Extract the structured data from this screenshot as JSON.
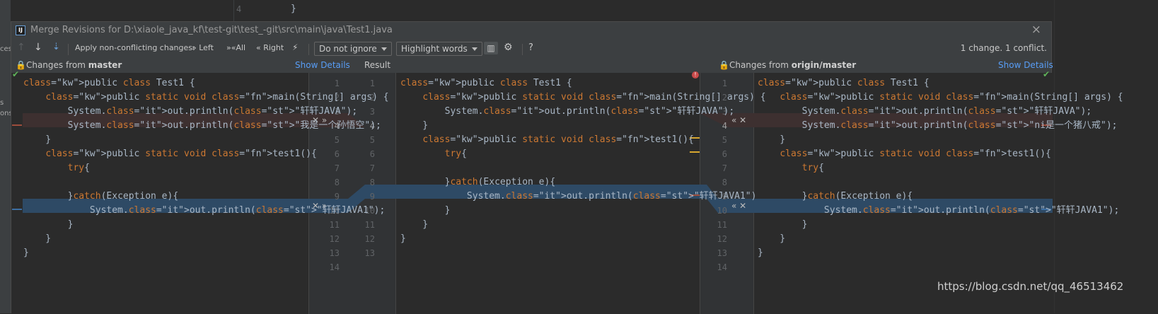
{
  "background": {
    "editor_line_number": "4",
    "editor_line_text": "}",
    "left_strip_fragments": [
      "s",
      "ces",
      "s",
      "ons"
    ]
  },
  "dialog": {
    "title": "Merge Revisions for D:\\xiaole_java_kf\\test-git\\test_-git\\src\\main\\java\\Test1.java",
    "logo_text": "IJ",
    "close_icon": "×"
  },
  "toolbar": {
    "up_arrow": "↑",
    "down_arrow": "↓",
    "apply_label": "Apply non-conflicting changes:",
    "left_label": "Left",
    "all_label": "All",
    "right_label": "Right",
    "ignore_option": "Do not ignore",
    "highlight_option": "Highlight words",
    "help_label": "?",
    "status": "1 change. 1 conflict."
  },
  "headers": {
    "left_prefix": "Changes from ",
    "left_branch": "master",
    "show_details": "Show Details",
    "result": "Result",
    "right_prefix": "Changes from ",
    "right_branch": "origin/master"
  },
  "gutter_numbers": [
    "1",
    "2",
    "3",
    "4",
    "5",
    "6",
    "7",
    "8",
    "9",
    "10",
    "11",
    "12",
    "13",
    "14"
  ],
  "result_numbers": [
    "1",
    "2",
    "3",
    "4",
    "5",
    "6",
    "7",
    "8",
    "9",
    "10",
    "11",
    "12",
    "13"
  ],
  "left_code": [
    "public class Test1 {",
    "    public static void main(String[] args) {",
    "        System.out.println(\"轩轩JAVA\");",
    "        System.out.println(\"我是一个孙悟空\");",
    "    }",
    "    public static void test1(){",
    "        try{",
    "",
    "        }catch(Exception e){",
    "            System.out.println(\"轩轩JAVA1\");",
    "        }",
    "    }",
    "}"
  ],
  "center_code": [
    "public class Test1 {",
    "    public static void main(String[] args) {",
    "        System.out.println(\"轩轩JAVA\");",
    "    }",
    "    public static void test1(){",
    "        try{",
    "",
    "        }catch(Exception e){",
    "            System.out.println(\"轩轩JAVA1\")",
    "        }",
    "    }",
    "}"
  ],
  "right_code": [
    "public class Test1 {",
    "    public static void main(String[] args) {",
    "        System.out.println(\"轩轩JAVA\");",
    "        System.out.println(\"ni是一个猪八戒\");",
    "    }",
    "    public static void test1(){",
    "        try{",
    "",
    "        }catch(Exception e){",
    "            System.out.println(\"轩轩JAVA1\");",
    "        }",
    "    }",
    "}"
  ],
  "actions": {
    "accept_left": "✕ »",
    "accept_right": "« ✕"
  },
  "watermark": "https://blog.csdn.net/qq_46513462"
}
